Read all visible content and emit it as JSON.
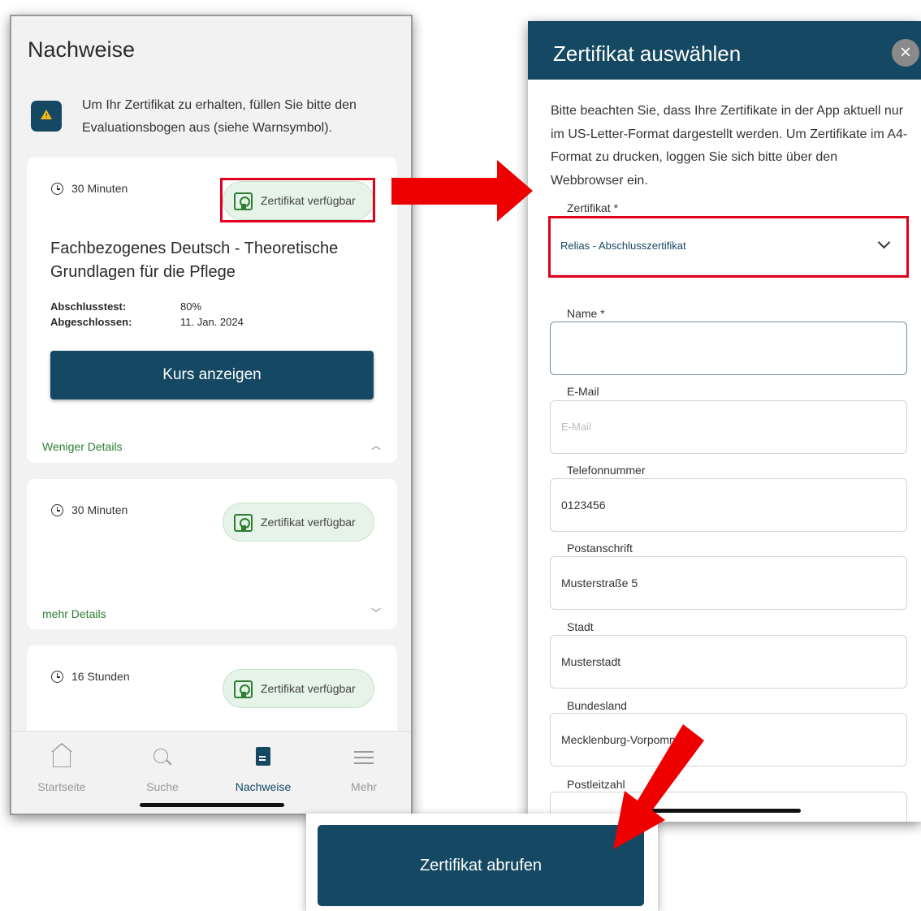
{
  "left_screen": {
    "title": "Nachweise",
    "warning_text": "Um Ihr Zertifikat zu erhalten, füllen Sie bitte den Evaluationsbogen aus (siehe Warnsymbol).",
    "cards": [
      {
        "duration": "30 Minuten",
        "certificate_badge": "Zertifikat verfügbar",
        "course_title": "Fachbezogenes Deutsch - Theoretische Grundlagen für die Pflege",
        "exam_label": "Abschlusstest:",
        "exam_value": "80%",
        "completed_label": "Abgeschlossen:",
        "completed_value": "11. Jan. 2024",
        "button_label": "Kurs anzeigen",
        "details_link": "Weniger Details"
      },
      {
        "duration": "30 Minuten",
        "certificate_badge": "Zertifikat verfügbar",
        "details_link": "mehr Details"
      },
      {
        "duration": "16 Stunden",
        "certificate_badge": "Zertifikat verfügbar"
      }
    ],
    "nav": [
      {
        "label": "Startseite",
        "icon": "home-icon"
      },
      {
        "label": "Suche",
        "icon": "search-icon"
      },
      {
        "label": "Nachweise",
        "icon": "document-icon",
        "active": true
      },
      {
        "label": "Mehr",
        "icon": "menu-icon"
      }
    ]
  },
  "right_screen": {
    "title": "Zertifikat auswählen",
    "close_icon": "close-icon",
    "notice": "Bitte beachten Sie, dass Ihre Zertifikate in der App aktuell nur im US-Letter-Format dargestellt werden. Um Zertifikate im A4-Format zu drucken, loggen Sie sich bitte über den Webbrowser ein.",
    "certificate_field": {
      "label": "Zertifikat *",
      "value": "Relias - Abschlusszertifikat"
    },
    "fields": [
      {
        "label": "Name *",
        "value": "",
        "placeholder": ""
      },
      {
        "label": "E-Mail",
        "value": "",
        "placeholder": "E-Mail"
      },
      {
        "label": "Telefonnummer",
        "value": "0123456",
        "placeholder": ""
      },
      {
        "label": "Postanschrift",
        "value": "Musterstraße 5",
        "placeholder": ""
      },
      {
        "label": "Stadt",
        "value": "Musterstadt",
        "placeholder": ""
      },
      {
        "label": "Bundesland",
        "value": "Mecklenburg-Vorpommern",
        "placeholder": ""
      },
      {
        "label": "Postleitzahl",
        "value": "",
        "placeholder": ""
      }
    ]
  },
  "submit_button": {
    "label": "Zertifikat abrufen"
  },
  "colors": {
    "primary": "#154862",
    "success_green": "#2e7d32",
    "badge_bg": "#e6f3e8",
    "highlight_red": "#e0001b",
    "warning_yellow": "#f5b90f"
  }
}
